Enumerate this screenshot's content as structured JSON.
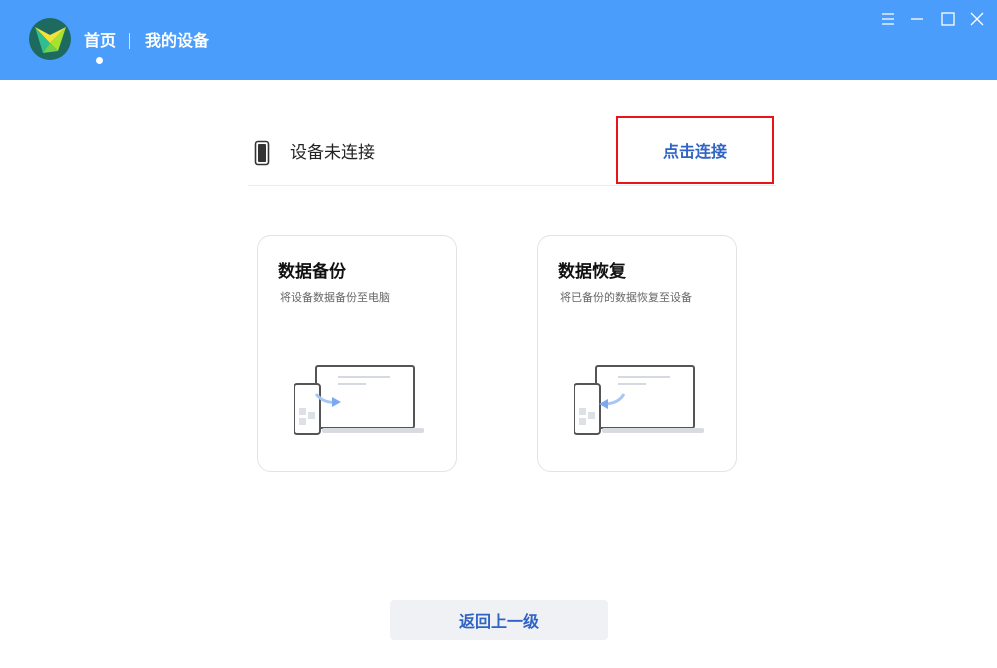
{
  "nav": {
    "home_label": "首页",
    "devices_label": "我的设备"
  },
  "window_controls": [
    "menu-icon",
    "minimize-icon",
    "maximize-icon",
    "close-icon"
  ],
  "status": {
    "icon": "phone-icon",
    "text": "设备未连接",
    "connect_label": "点击连接"
  },
  "cards": [
    {
      "title": "数据备份",
      "description": "将设备数据备份至电脑",
      "icon": "backup-illustration"
    },
    {
      "title": "数据恢复",
      "description": "将已备份的数据恢复至设备",
      "icon": "restore-illustration"
    }
  ],
  "footer": {
    "back_label": "返回上一级"
  },
  "colors": {
    "header_bg": "#4a9dfa",
    "link_blue": "#2f63c4",
    "highlight_red": "#e8141a",
    "button_bg": "#f0f1f4"
  }
}
